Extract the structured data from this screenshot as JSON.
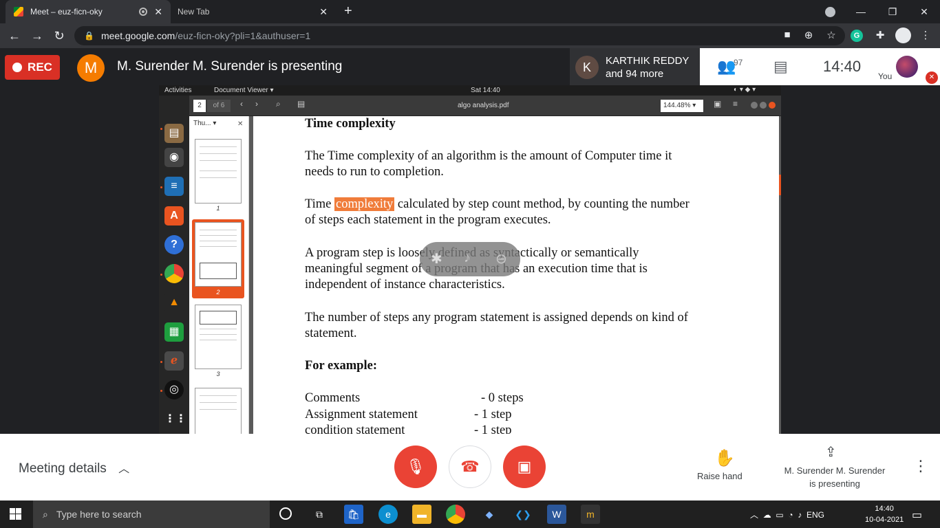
{
  "browser": {
    "tabs": [
      {
        "title": "Meet – euz-ficn-oky",
        "active": true
      },
      {
        "title": "New Tab",
        "active": false
      }
    ],
    "url_host": "meet.google.com",
    "url_path": "/euz-ficn-oky?pli=1&authuser=1"
  },
  "meet": {
    "rec_label": "REC",
    "presenter_initial": "M",
    "presenting_title": "M. Surender M. Surender is presenting",
    "participant_initial": "K",
    "participant_name": "KARTHIK REDDY",
    "participant_more": "and 94 more",
    "people_count": "97",
    "time": "14:40",
    "you_label": "You",
    "meeting_details_label": "Meeting details",
    "raise_hand_label": "Raise hand",
    "presenting_line1": "M. Surender M. Surender",
    "presenting_line2": "is presenting"
  },
  "shared_screen": {
    "activities": "Activities",
    "app_menu": "Document Viewer ▾",
    "clock": "Sat 14:40",
    "page_current": "2",
    "page_of": "of 6",
    "doc_title": "algo analysis.pdf",
    "zoom": "144.48% ▾",
    "sidebar_mode": "Thu... ▾",
    "thumbnail_numbers": [
      "1",
      "2",
      "3"
    ],
    "heading": "Time complexity",
    "para1_line1": "The Time complexity of an algorithm is the amount of Computer time it",
    "para1_line2": "needs to run to completion.",
    "para2_before": "Time ",
    "para2_highlight": "complexity",
    "para2_after": " calculated by step count method, by counting the number",
    "para2_line2": "of steps each statement in the program executes.",
    "para3_line1": "A program step is loosely defined as syntactically or semantically",
    "para3_line2": "meaningful segment of a program that has an execution time that is",
    "para3_line3": "independent of instance characteristics.",
    "para4_line1": "The number of steps any program statement is assigned depends on kind of",
    "para4_line2": "statement.",
    "example_heading": "For example:",
    "rows": [
      {
        "label": "Comments",
        "value": "- 0 steps"
      },
      {
        "label": "Assignment statement",
        "value": "- 1 step"
      },
      {
        "label": "condition statement",
        "value": "- 1 step"
      }
    ]
  },
  "taskbar": {
    "search_placeholder": "Type here to search",
    "lang": "ENG",
    "time": "14:40",
    "date": "10-04-2021"
  },
  "colors": {
    "rec_red": "#d93025",
    "presenter_orange": "#f57c00",
    "highlight_orange": "#f07c3a",
    "ubuntu_orange": "#e95420"
  }
}
